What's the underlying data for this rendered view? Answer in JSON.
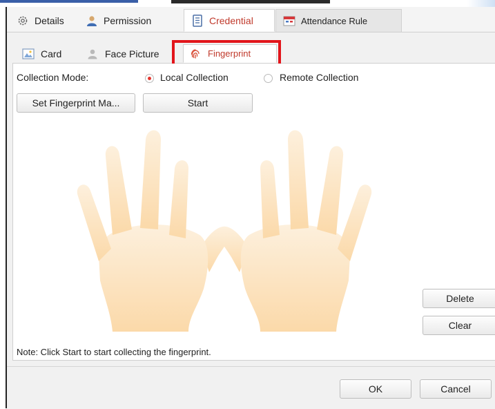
{
  "main_tabs": [
    {
      "label": "Details",
      "icon": "gear-icon"
    },
    {
      "label": "Permission",
      "icon": "user-icon"
    },
    {
      "label": "Credential",
      "icon": "card-icon",
      "active": true
    },
    {
      "label": "Attendance Rule",
      "icon": "calendar-icon"
    }
  ],
  "sub_tabs": [
    {
      "label": "Card",
      "icon": "card-image-icon"
    },
    {
      "label": "Face Picture",
      "icon": "person-icon"
    },
    {
      "label": "Fingerprint",
      "icon": "fingerprint-icon",
      "active": true
    }
  ],
  "collection": {
    "label": "Collection Mode:",
    "options": [
      "Local Collection",
      "Remote Collection"
    ],
    "selected": "Local Collection"
  },
  "buttons": {
    "set_fingerprint": "Set Fingerprint Ma...",
    "start": "Start",
    "delete": "Delete",
    "clear": "Clear",
    "ok": "OK",
    "cancel": "Cancel"
  },
  "note": "Note: Click Start to start collecting the fingerprint.",
  "colors": {
    "accent": "#c0392b",
    "highlight": "#e2151b",
    "hand": "#fde0b8"
  }
}
